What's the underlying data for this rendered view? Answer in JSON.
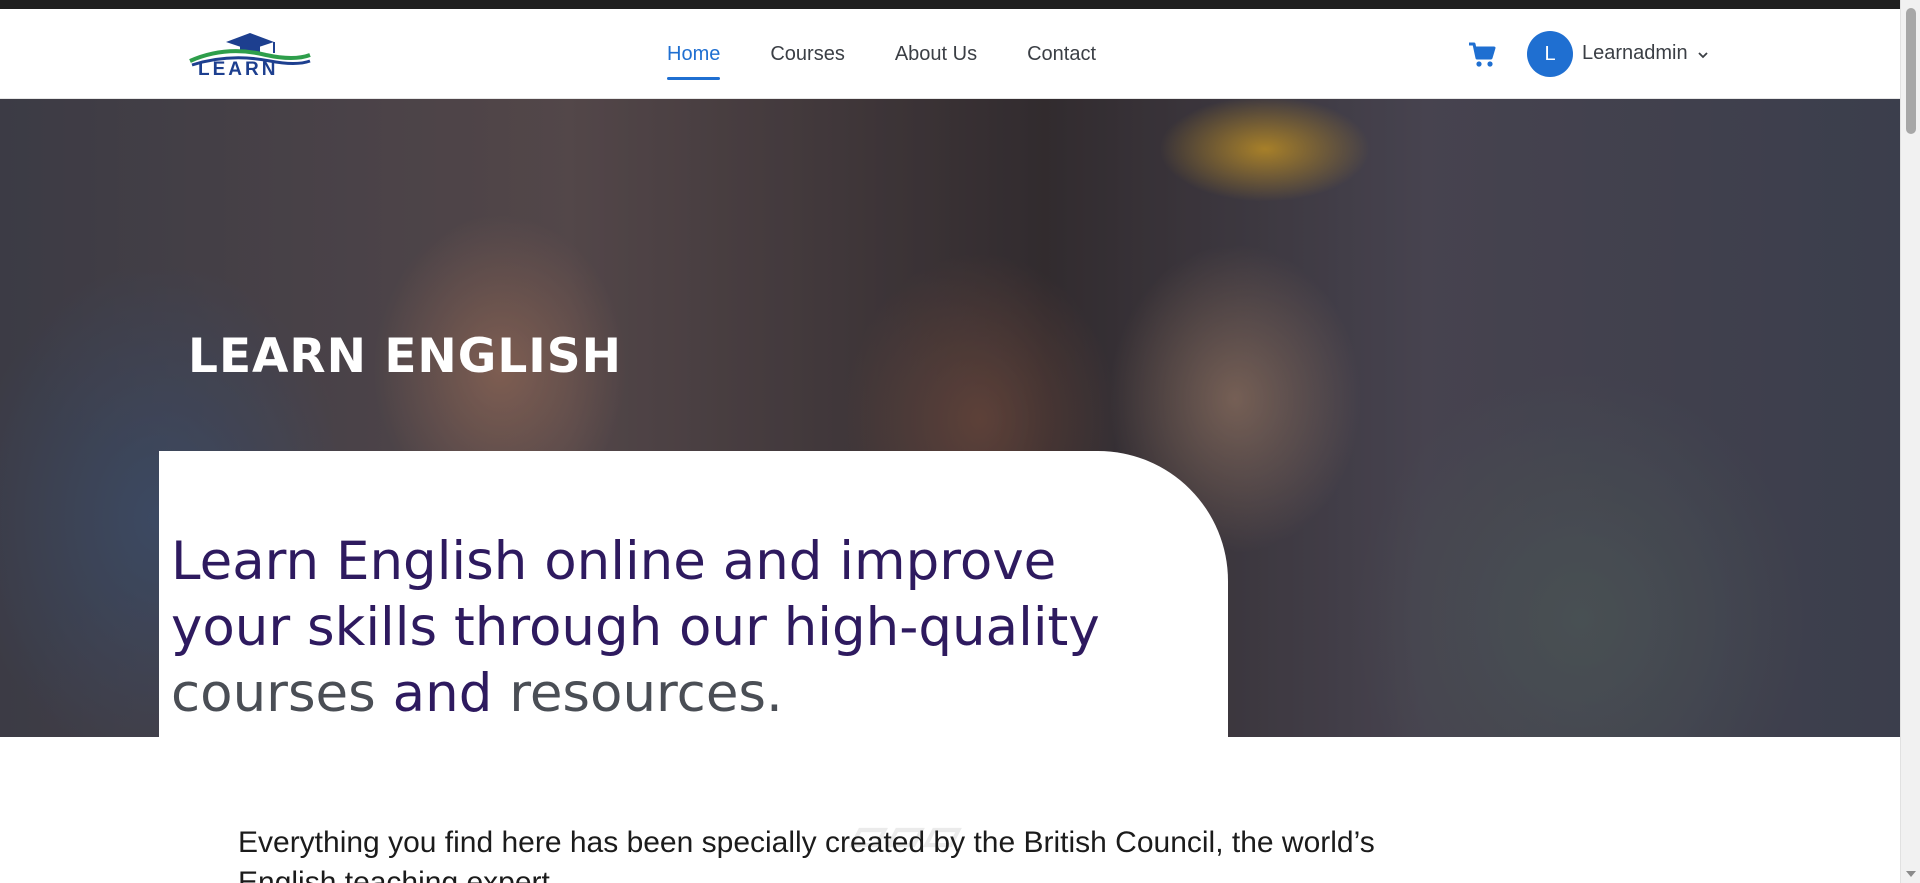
{
  "header": {
    "logo_text": "LEARN",
    "nav": [
      {
        "label": "Home",
        "active": true
      },
      {
        "label": "Courses",
        "active": false
      },
      {
        "label": "About Us",
        "active": false
      },
      {
        "label": "Contact",
        "active": false
      }
    ],
    "user": {
      "initial": "L",
      "name": "Learnadmin"
    },
    "icons": {
      "cart": "cart-icon",
      "chevron": "chevron-down-icon"
    }
  },
  "hero": {
    "title": "LEARN ENGLISH",
    "card_text": {
      "part1": "Learn English online and improve your skills through our high-quality ",
      "part2": "courses",
      "part3": " and ",
      "part4": "resources."
    }
  },
  "intro": {
    "line1": "Everything you find here has been specially created by the British Council, the world’s",
    "line2": "English teaching expert"
  },
  "colors": {
    "accent": "#1f6fd1",
    "hero_heading": "#2e1a5f",
    "hero_muted": "#4a4e55"
  }
}
